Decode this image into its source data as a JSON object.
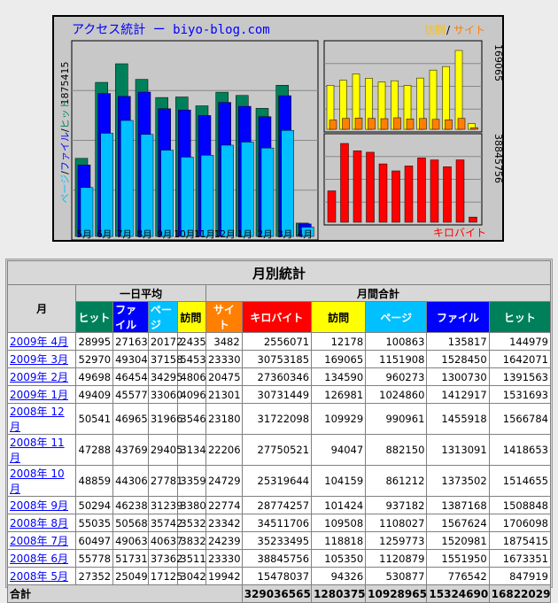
{
  "chart": {
    "title": "アクセス統計 ー  biyo-blog.com",
    "legend_right_visits": "訪問",
    "legend_right_sep": "/",
    "legend_right_sites": "サイト",
    "left_axis_max": "1875415",
    "left_axis_label_pages": "ページ",
    "left_axis_label_files": "ファイル",
    "left_axis_label_hits": "ヒット",
    "left_axis_sep": "/",
    "right_top_axis_max": "169065",
    "right_bottom_axis_max": "38845756",
    "right_bottom_label": "キロバイト",
    "colors": {
      "hits": "#00805a",
      "files": "#0000ff",
      "pages": "#00c0ff",
      "visits": "#ffff00",
      "sites": "#ff8000",
      "kbytes": "#ff0000",
      "visits_text": "#ffc000",
      "sites_text": "#ff7f00"
    }
  },
  "chart_data": {
    "type": "bar",
    "categories": [
      "5月",
      "6月",
      "7月",
      "8月",
      "9月",
      "10月",
      "11月",
      "12月",
      "1月",
      "2月",
      "3月",
      "4月"
    ],
    "series": [
      {
        "name": "ヒット",
        "values": [
          847919,
          1673351,
          1875415,
          1706098,
          1508848,
          1514655,
          1418653,
          1566784,
          1531693,
          1391563,
          1642071,
          144979
        ]
      },
      {
        "name": "ファイル",
        "values": [
          776542,
          1551950,
          1520981,
          1567624,
          1387168,
          1373502,
          1313091,
          1455918,
          1412917,
          1300730,
          1528450,
          135817
        ]
      },
      {
        "name": "ページ",
        "values": [
          530877,
          1120879,
          1259773,
          1108027,
          937182,
          861212,
          882150,
          990961,
          1024860,
          960273,
          1151908,
          100863
        ]
      },
      {
        "name": "訪問",
        "values": [
          94326,
          105350,
          118818,
          109508,
          101424,
          104159,
          94047,
          109929,
          126981,
          134590,
          169065,
          12178
        ]
      },
      {
        "name": "サイト",
        "values": [
          19942,
          23330,
          24239,
          23342,
          22774,
          24729,
          22206,
          23180,
          21301,
          20475,
          23330,
          3482
        ]
      },
      {
        "name": "キロバイト",
        "values": [
          15478037,
          38845756,
          35233495,
          34511706,
          28774257,
          25319644,
          27750521,
          31722098,
          30731449,
          27360346,
          30753185,
          2556071
        ]
      }
    ]
  },
  "table": {
    "title": "月別統計",
    "month_header": "月",
    "daily_avg_header": "一日平均",
    "monthly_total_header": "月間合計",
    "daily_cols": [
      "ヒット",
      "ファイル",
      "ページ",
      "訪問"
    ],
    "total_cols": [
      "サイト",
      "キロバイト",
      "訪問",
      "ページ",
      "ファイル",
      "ヒット"
    ],
    "rows": [
      {
        "month": "2009年 4月",
        "d": [
          "28995",
          "27163",
          "20172",
          "2435"
        ],
        "t": [
          "3482",
          "2556071",
          "12178",
          "100863",
          "135817",
          "144979"
        ]
      },
      {
        "month": "2009年 3月",
        "d": [
          "52970",
          "49304",
          "37158",
          "5453"
        ],
        "t": [
          "23330",
          "30753185",
          "169065",
          "1151908",
          "1528450",
          "1642071"
        ]
      },
      {
        "month": "2009年 2月",
        "d": [
          "49698",
          "46454",
          "34295",
          "4806"
        ],
        "t": [
          "20475",
          "27360346",
          "134590",
          "960273",
          "1300730",
          "1391563"
        ]
      },
      {
        "month": "2009年 1月",
        "d": [
          "49409",
          "45577",
          "33060",
          "4096"
        ],
        "t": [
          "21301",
          "30731449",
          "126981",
          "1024860",
          "1412917",
          "1531693"
        ]
      },
      {
        "month": "2008年 12月",
        "d": [
          "50541",
          "46965",
          "31966",
          "3546"
        ],
        "t": [
          "23180",
          "31722098",
          "109929",
          "990961",
          "1455918",
          "1566784"
        ]
      },
      {
        "month": "2008年 11月",
        "d": [
          "47288",
          "43769",
          "29405",
          "3134"
        ],
        "t": [
          "22206",
          "27750521",
          "94047",
          "882150",
          "1313091",
          "1418653"
        ]
      },
      {
        "month": "2008年 10月",
        "d": [
          "48859",
          "44306",
          "27781",
          "3359"
        ],
        "t": [
          "24729",
          "25319644",
          "104159",
          "861212",
          "1373502",
          "1514655"
        ]
      },
      {
        "month": "2008年 9月",
        "d": [
          "50294",
          "46238",
          "31239",
          "3380"
        ],
        "t": [
          "22774",
          "28774257",
          "101424",
          "937182",
          "1387168",
          "1508848"
        ]
      },
      {
        "month": "2008年 8月",
        "d": [
          "55035",
          "50568",
          "35742",
          "3532"
        ],
        "t": [
          "23342",
          "34511706",
          "109508",
          "1108027",
          "1567624",
          "1706098"
        ]
      },
      {
        "month": "2008年 7月",
        "d": [
          "60497",
          "49063",
          "40637",
          "3832"
        ],
        "t": [
          "24239",
          "35233495",
          "118818",
          "1259773",
          "1520981",
          "1875415"
        ]
      },
      {
        "month": "2008年 6月",
        "d": [
          "55778",
          "51731",
          "37362",
          "3511"
        ],
        "t": [
          "23330",
          "38845756",
          "105350",
          "1120879",
          "1551950",
          "1673351"
        ]
      },
      {
        "month": "2008年 5月",
        "d": [
          "27352",
          "25049",
          "17125",
          "3042"
        ],
        "t": [
          "19942",
          "15478037",
          "94326",
          "530877",
          "776542",
          "847919"
        ]
      }
    ],
    "total_label": "合計",
    "totals": [
      "329036565",
      "1280375",
      "10928965",
      "15324690",
      "16822029"
    ]
  }
}
